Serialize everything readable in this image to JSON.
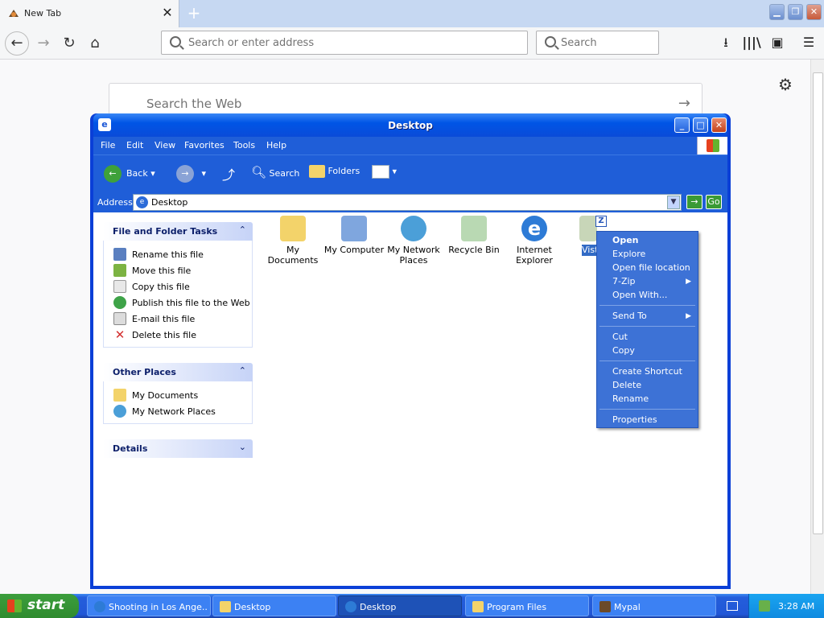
{
  "browser": {
    "tab_title": "New Tab",
    "tab_close": "✕",
    "new_tab": "+",
    "url_placeholder": "Search or enter address",
    "search_placeholder": "Search",
    "newtab_search_placeholder": "Search the Web",
    "icons": [
      "back-icon",
      "forward-icon",
      "reload-icon",
      "home-icon",
      "download-icon",
      "library-icon",
      "sidebar-icon",
      "menu-icon",
      "settings-gear-icon"
    ]
  },
  "window": {
    "title": "Desktop",
    "menu": [
      "File",
      "Edit",
      "View",
      "Favorites",
      "Tools",
      "Help"
    ],
    "toolbar": {
      "back": "Back",
      "search": "Search",
      "folders": "Folders"
    },
    "address_label": "Address",
    "address_value": "Desktop",
    "go_label": "Go"
  },
  "tasks_panel": {
    "title": "File and Folder Tasks",
    "items": [
      "Rename this file",
      "Move this file",
      "Copy this file",
      "Publish this file to the Web",
      "E-mail this file",
      "Delete this file"
    ]
  },
  "places_panel": {
    "title": "Other Places",
    "items": [
      "My Documents",
      "My Network Places"
    ]
  },
  "details_panel": {
    "title": "Details"
  },
  "desktop_icons": [
    {
      "label": "My Documents",
      "icon": "folder-documents-icon",
      "color": "#f3d36a"
    },
    {
      "label": "My Computer",
      "icon": "computer-icon",
      "color": "#7fa6de"
    },
    {
      "label": "My Network Places",
      "icon": "network-globe-icon",
      "color": "#4b9fd8"
    },
    {
      "label": "Recycle Bin",
      "icon": "recycle-bin-icon",
      "color": "#b9d9b3"
    },
    {
      "label": "Internet Explorer",
      "icon": "internet-explorer-icon",
      "color": "#2d7bd6"
    },
    {
      "label": "Vista",
      "icon": "file-icon",
      "color": "#c8d6b8"
    }
  ],
  "selected_label_fragment": "Vist",
  "context_menu": {
    "open": "Open",
    "explore": "Explore",
    "open_location": "Open file location",
    "zip": "7-Zip",
    "open_with": "Open With...",
    "send_to": "Send To",
    "cut": "Cut",
    "copy": "Copy",
    "create_shortcut": "Create Shortcut",
    "delete": "Delete",
    "rename": "Rename",
    "properties": "Properties"
  },
  "taskbar": {
    "start": "start",
    "tasks": [
      "Shooting in Los Ange...",
      "Desktop",
      "Desktop",
      "Program Files",
      "Mypal"
    ],
    "active_index": 2,
    "clock": "3:28 AM"
  },
  "colors": {
    "xp_blue": "#1f5ed8",
    "start_green": "#3c9e3c",
    "context_blue": "#3d72d6"
  }
}
